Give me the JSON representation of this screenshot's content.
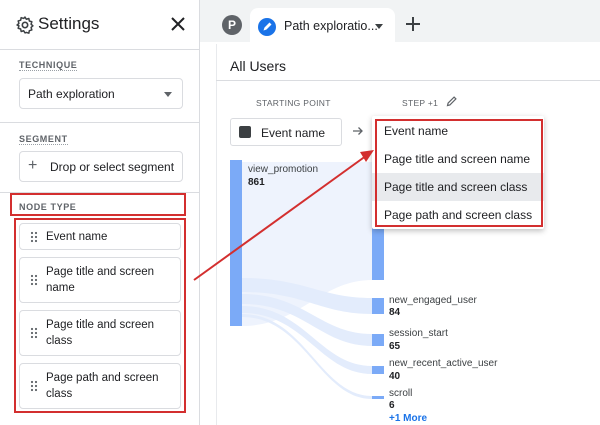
{
  "sidebar": {
    "title": "Settings",
    "technique": {
      "label": "TECHNIQUE",
      "value": "Path exploration"
    },
    "segment": {
      "label": "SEGMENT",
      "placeholder": "Drop or select segment"
    },
    "node_type": {
      "label": "NODE TYPE",
      "items": [
        {
          "label": "Event name"
        },
        {
          "label": "Page title and screen name"
        },
        {
          "label": "Page title and screen class"
        },
        {
          "label": "Page path and screen class"
        }
      ]
    }
  },
  "tabs": {
    "avatar_letter": "P",
    "active_label": "Path exploratio...",
    "active_label_value": "Path exploratio"
  },
  "canvas": {
    "title": "All Users",
    "starting_point_label": "STARTING POINT",
    "step_label": "STEP +1",
    "starting_node_selector": "Event name",
    "start_node": {
      "name": "view_promotion",
      "count": "861"
    },
    "step_nodes": [
      {
        "name": "new_engaged_user",
        "count": "84"
      },
      {
        "name": "session_start",
        "count": "65"
      },
      {
        "name": "new_recent_active_user",
        "count": "40"
      },
      {
        "name": "scroll",
        "count": "6"
      }
    ],
    "more_link": "+1 More",
    "dropdown_options": [
      {
        "label": "Event name"
      },
      {
        "label": "Page title and screen name"
      },
      {
        "label": "Page title and screen class"
      },
      {
        "label": "Page path and screen class"
      }
    ],
    "dropdown_highlighted": 2
  },
  "colors": {
    "accent": "#1a73e8",
    "annotation_red": "#d32f2f",
    "node_bar": "#7baaf7",
    "flow_band": "#e8f0fe"
  }
}
